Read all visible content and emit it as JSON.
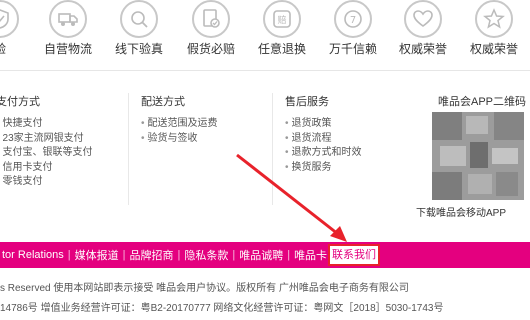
{
  "services": [
    {
      "label": "验",
      "icon": "shield-check-icon"
    },
    {
      "label": "自营物流",
      "icon": "truck-icon"
    },
    {
      "label": "线下验真",
      "icon": "verify-icon"
    },
    {
      "label": "假货必赔",
      "icon": "document-check-icon"
    },
    {
      "label": "任意退换",
      "icon": "compensation-icon"
    },
    {
      "label": "万千信赖",
      "icon": "seven-day-return-icon"
    },
    {
      "label": "权威荣誉",
      "icon": "heart-icon"
    }
  ],
  "columns": {
    "payment": {
      "title": "支付方式",
      "items": [
        "快捷支付",
        "23家主流网银支付",
        "支付宝、银联等支付",
        "信用卡支付",
        "零钱支付"
      ]
    },
    "delivery": {
      "title": "配送方式",
      "items": [
        "配送范围及运费",
        "验货与签收"
      ]
    },
    "aftersale": {
      "title": "售后服务",
      "items": [
        "退货政策",
        "退货流程",
        "退款方式和时效",
        "换货服务"
      ]
    }
  },
  "qr": {
    "title": "唯品会APP二维码",
    "caption": "下载唯品会移动APP"
  },
  "footer_links": [
    "tor Relations",
    "媒体报道",
    "品牌招商",
    "隐私条款",
    "唯品诚聘",
    "唯品卡"
  ],
  "highlighted_link": "联系我们",
  "footer_text": {
    "line1": "s Reserved  使用本网站即表示接受 唯品会用户协议。版权所有 广州唯品会电子商务有限公司",
    "line2": "14786号  增值业务经营许可证：粤B2-20170777  网络文化经营许可证：粤网文［2018］5030-1743号"
  },
  "colors": {
    "brand_pink": "#e4007f",
    "annotation_red": "#e8222b"
  }
}
